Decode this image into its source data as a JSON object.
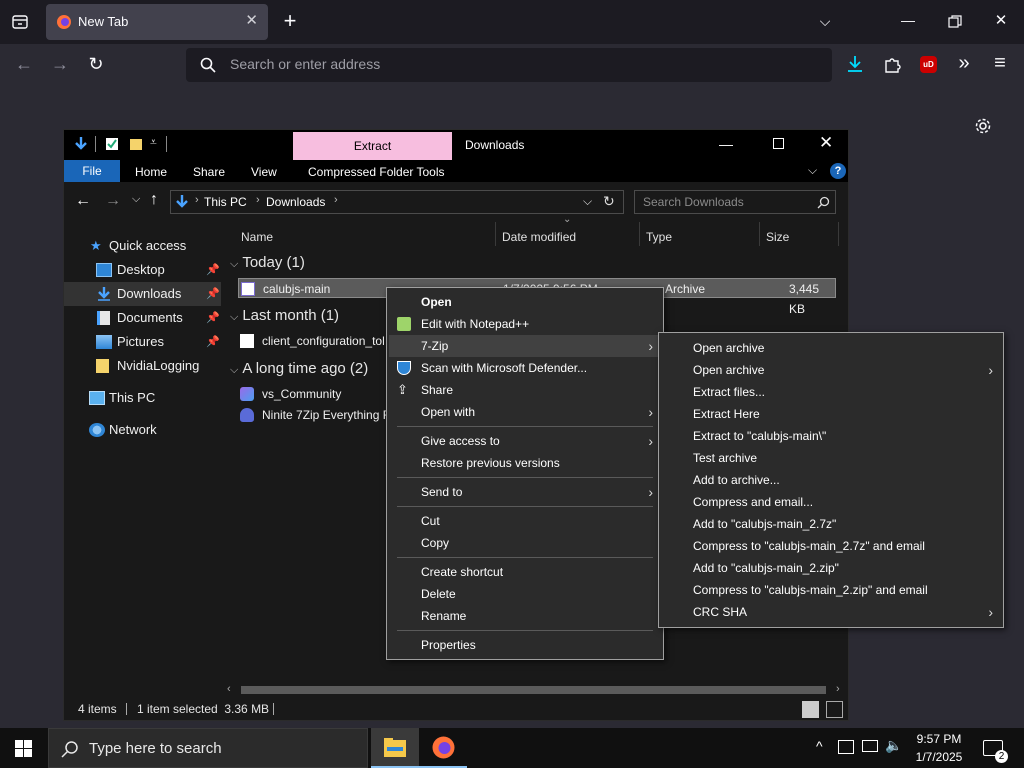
{
  "browser": {
    "tab_title": "New Tab",
    "url_placeholder": "Search or enter address",
    "ublock_badge": "uD"
  },
  "explorer": {
    "ribbon_context_tab": "Extract",
    "window_title": "Downloads",
    "ribbon_tabs": {
      "file": "File",
      "home": "Home",
      "share": "Share",
      "view": "View",
      "compressed": "Compressed Folder Tools"
    },
    "breadcrumb": [
      "This PC",
      "Downloads"
    ],
    "search_placeholder": "Search Downloads",
    "nav": [
      {
        "label": "Quick access"
      },
      {
        "label": "Desktop"
      },
      {
        "label": "Downloads"
      },
      {
        "label": "Documents"
      },
      {
        "label": "Pictures"
      },
      {
        "label": "NvidiaLogging"
      },
      {
        "label": "This PC"
      },
      {
        "label": "Network"
      }
    ],
    "columns": {
      "name": "Name",
      "date": "Date modified",
      "type": "Type",
      "size": "Size"
    },
    "groups": {
      "today": "Today (1)",
      "last_month": "Last month (1)",
      "long_ago": "A long time ago (2)"
    },
    "files": {
      "calubjs": {
        "name": "calubjs-main",
        "date": "1/7/2025 9:56 PM",
        "type": "Archive",
        "size": "3,445 KB"
      },
      "client": {
        "name": "client_configuration_tol"
      },
      "vs": {
        "name": "vs_Community"
      },
      "ninite": {
        "name": "Ninite 7Zip Everything F"
      }
    },
    "status": {
      "count": "4 items",
      "selected": "1 item selected  3.36 MB"
    }
  },
  "context_menu": {
    "items": {
      "open": "Open",
      "notepad": "Edit with Notepad++",
      "sevenzip": "7-Zip",
      "defender": "Scan with Microsoft Defender...",
      "share": "Share",
      "open_with": "Open with",
      "give_access": "Give access to",
      "restore": "Restore previous versions",
      "send_to": "Send to",
      "cut": "Cut",
      "copy": "Copy",
      "shortcut": "Create shortcut",
      "delete": "Delete",
      "rename": "Rename",
      "properties": "Properties"
    }
  },
  "sevenzip_menu": {
    "items": [
      "Open archive",
      "Open archive",
      "Extract files...",
      "Extract Here",
      "Extract to \"calubjs-main\\\"",
      "Test archive",
      "Add to archive...",
      "Compress and email...",
      "Add to \"calubjs-main_2.7z\"",
      "Compress to \"calubjs-main_2.7z\" and email",
      "Add to \"calubjs-main_2.zip\"",
      "Compress to \"calubjs-main_2.zip\" and email",
      "CRC SHA"
    ]
  },
  "taskbar": {
    "search_placeholder": "Type here to search",
    "time": "9:57 PM",
    "date": "1/7/2025",
    "notification_count": "2"
  }
}
